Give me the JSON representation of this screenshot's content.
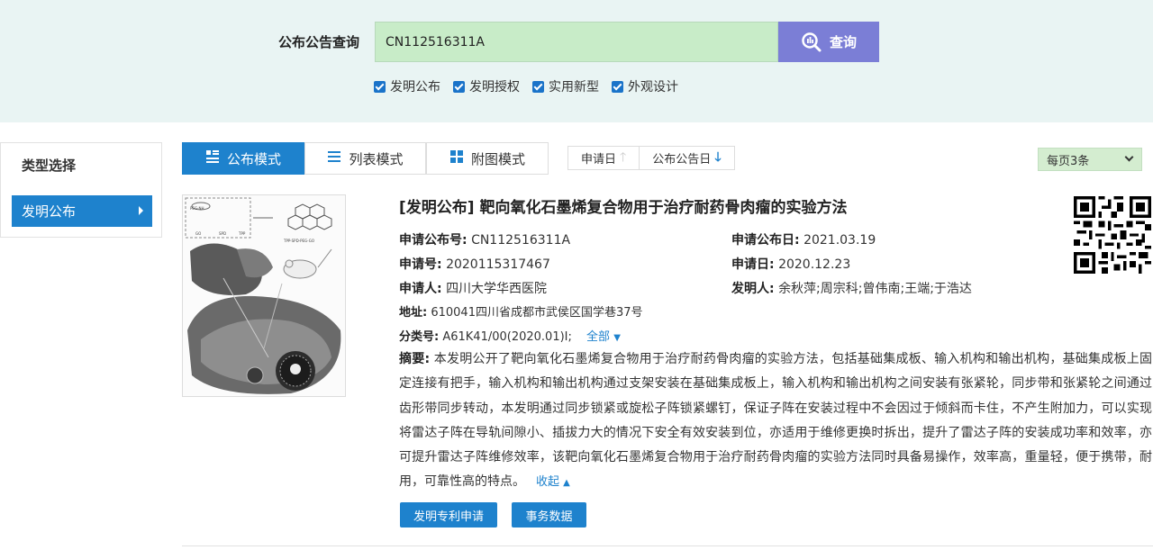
{
  "search": {
    "label": "公布公告查询",
    "value": "CN112516311A",
    "button_label": "查询"
  },
  "types": [
    {
      "label": "发明公布",
      "checked": true
    },
    {
      "label": "发明授权",
      "checked": true
    },
    {
      "label": "实用新型",
      "checked": true
    },
    {
      "label": "外观设计",
      "checked": true
    }
  ],
  "sidebar": {
    "title": "类型选择",
    "items": [
      {
        "label": "发明公布",
        "active": true
      }
    ]
  },
  "modes": [
    {
      "label": "公布模式",
      "icon": "list-icon",
      "active": true
    },
    {
      "label": "列表模式",
      "icon": "menu-icon",
      "active": false
    },
    {
      "label": "附图模式",
      "icon": "grid-icon",
      "active": false
    }
  ],
  "sort": {
    "apply_date": "申请日",
    "publish_date": "公布公告日"
  },
  "per_page": "每页3条",
  "result": {
    "title": "[发明公布] 靶向氧化石墨烯复合物用于治疗耐药骨肉瘤的实验方法",
    "pub_no_label": "申请公布号:",
    "pub_no": "CN112516311A",
    "pub_date_label": "申请公布日:",
    "pub_date": "2021.03.19",
    "app_no_label": "申请号:",
    "app_no": "2020115317467",
    "app_date_label": "申请日:",
    "app_date": "2020.12.23",
    "applicant_label": "申请人:",
    "applicant": "四川大学华西医院",
    "inventor_label": "发明人:",
    "inventors": "余秋萍;周宗科;曾伟南;王端;于浩达",
    "address_label": "地址:",
    "address": "610041四川省成都市武侯区国学巷37号",
    "class_label": "分类号:",
    "class": "A61K41/00(2020.01)I;",
    "class_all": "全部",
    "abstract_label": "摘要:",
    "abstract": "本发明公开了靶向氧化石墨烯复合物用于治疗耐药骨肉瘤的实验方法，包括基础集成板、输入机构和输出机构，基础集成板上固定连接有把手，输入机构和输出机构通过支架安装在基础集成板上，输入机构和输出机构之间安装有张紧轮，同步带和张紧轮之间通过齿形带同步转动，本发明通过同步锁紧或旋松子阵锁紧螺钉，保证子阵在安装过程中不会因过于倾斜而卡住，不产生附加力，可以实现将雷达子阵在导轨间隙小、插拔力大的情况下安全有效安装到位，亦适用于维修更换时拆出，提升了雷达子阵的安装成功率和效率，亦可提升雷达子阵维修效率，该靶向氧化石墨烯复合物用于治疗耐药骨肉瘤的实验方法同时具备易操作，效率高，重量轻，便于携带，耐用，可靠性高的特点。",
    "collapse_label": "收起",
    "figure_labels": [
      "PEG-NH",
      "GO",
      "SPD",
      "TPP",
      "TPP-SPD-PEG-GO"
    ]
  },
  "actions": {
    "apply_label": "发明专利申请",
    "data_label": "事务数据"
  },
  "colors": {
    "accent": "#1e82cd",
    "search_button": "#7b7ed6",
    "search_input": "#c8ecc8",
    "header_band": "#e9f4f3"
  }
}
